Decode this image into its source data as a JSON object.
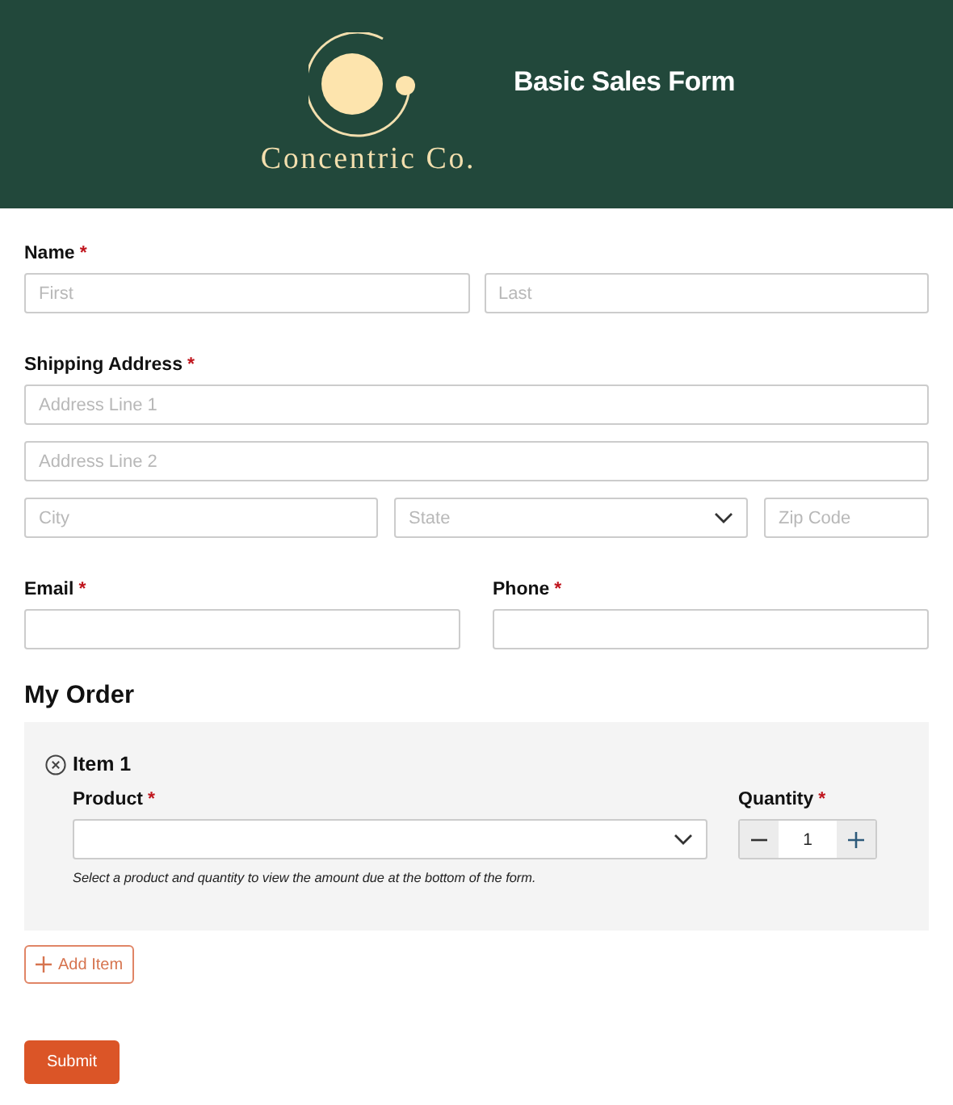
{
  "header": {
    "company": "Concentric Co.",
    "title": "Basic Sales Form"
  },
  "rows": [
    [
      {
        "label": "Name",
        "required_mark": "*",
        "lines": [
          [
            {
              "kind": "text",
              "placeholder": "First"
            },
            {
              "kind": "text",
              "placeholder": "Last"
            }
          ]
        ]
      }
    ],
    [
      {
        "label": "Shipping Address",
        "required_mark": "*",
        "lines": [
          [
            {
              "kind": "text",
              "placeholder": "Address Line 1"
            }
          ],
          [
            {
              "kind": "text",
              "placeholder": "Address Line 2"
            }
          ],
          [
            {
              "kind": "text",
              "placeholder": "City"
            },
            {
              "kind": "select",
              "placeholder": "State"
            },
            {
              "kind": "text",
              "placeholder": "Zip Code"
            }
          ]
        ]
      }
    ],
    [
      {
        "label": "Email",
        "required_mark": "*",
        "lines": [
          [
            {
              "kind": "text"
            }
          ]
        ]
      },
      {
        "label": "Phone",
        "required_mark": "*",
        "lines": [
          [
            {
              "kind": "text"
            }
          ]
        ]
      }
    ]
  ],
  "order": {
    "heading": "My Order",
    "items": [
      {
        "title": "Item 1",
        "product": {
          "label": "Product",
          "required_mark": "*"
        },
        "quantity": {
          "label": "Quantity",
          "required_mark": "*",
          "value": "1"
        },
        "note": "Select a product and quantity to view the amount due at the bottom of the form."
      }
    ],
    "add_button": "Add Item"
  },
  "submit": "Submit"
}
